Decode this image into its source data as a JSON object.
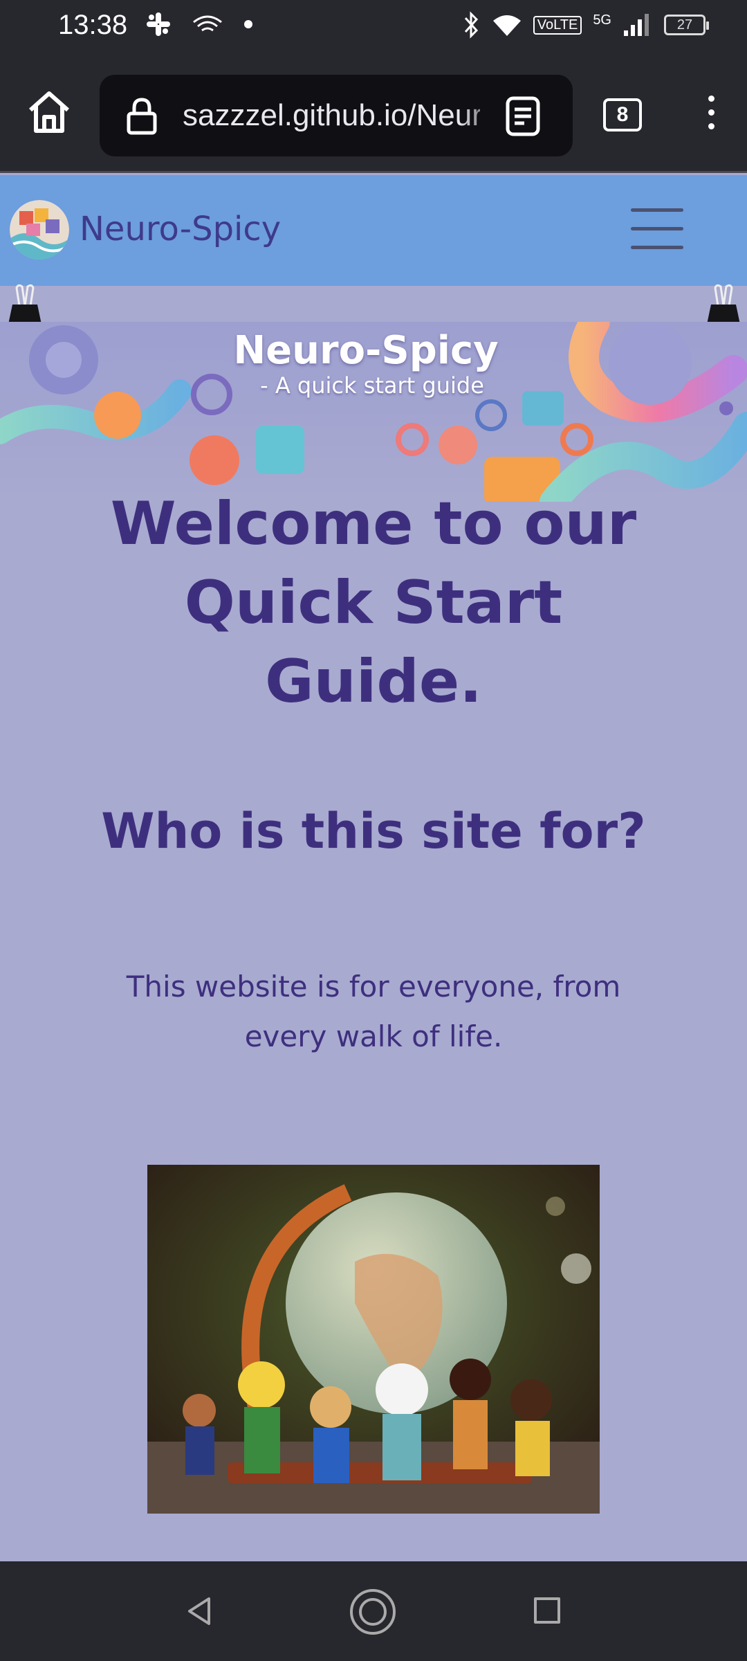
{
  "status_bar": {
    "time": "13:38",
    "network_label": "VoLTE",
    "network_gen": "5G",
    "battery": "27"
  },
  "browser": {
    "url": "sazzzel.github.io/Neuro-Spicy",
    "tab_count": "8"
  },
  "site": {
    "brand": "Neuro-Spicy",
    "banner_title": "Neuro-Spicy",
    "banner_subtitle": "- A quick start guide",
    "welcome_heading": "Welcome to our Quick Start Guide.",
    "section_heading": "Who is this site for?",
    "description": "This website is for everyone, from every walk of life."
  },
  "colors": {
    "page_bg": "#a8aad0",
    "nav_bg": "#6d9ede",
    "heading": "#3e2f7e",
    "chrome": "#27272e"
  },
  "icons": [
    "home-icon",
    "lock-icon",
    "reader-mode-icon",
    "more-vert-icon",
    "hamburger-icon",
    "back-icon",
    "home-circle-icon",
    "recents-icon",
    "slack-icon",
    "wifi-icon",
    "bluetooth-icon",
    "signal-icon",
    "battery-icon"
  ]
}
